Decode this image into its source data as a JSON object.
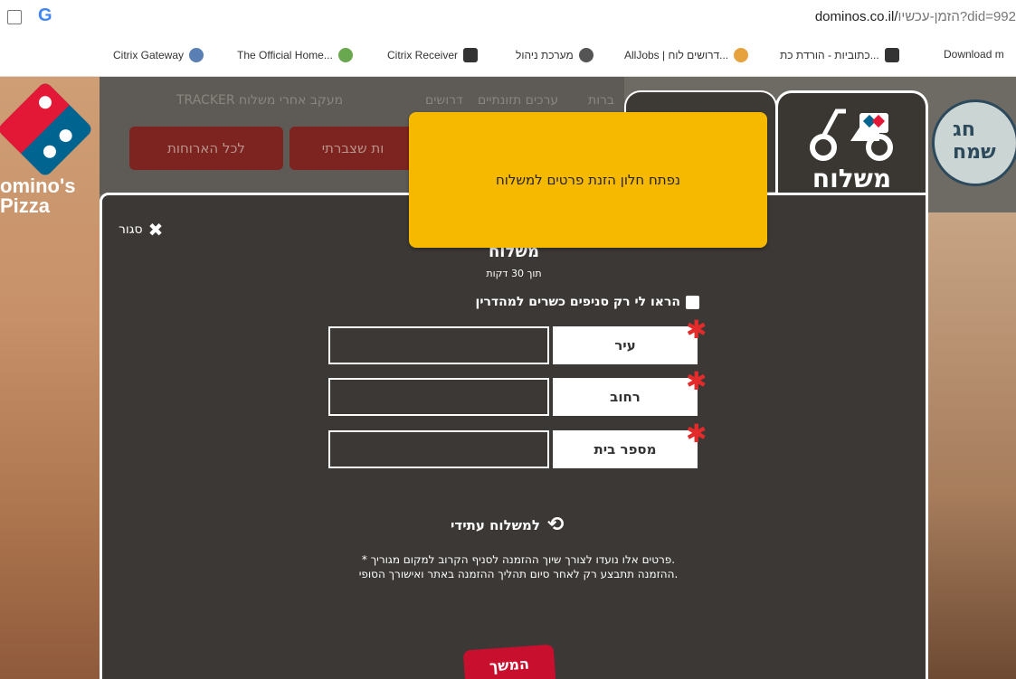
{
  "browser": {
    "url_host": "dominos.co.il/",
    "url_path": "הזמן-עכשיו?did=992",
    "google_icon": "G",
    "bookmarks": [
      {
        "label": "Citrix Gateway",
        "icon": "lock-icon",
        "color": "#5a7fb5"
      },
      {
        "label": "The Official Home...",
        "icon": "site-icon",
        "color": "#6aa84f"
      },
      {
        "label": "Citrix Receiver",
        "icon": "receiver-icon",
        "color": "#333333"
      },
      {
        "label": "מערכת ניהול",
        "icon": "globe-icon",
        "color": "#555555"
      },
      {
        "label": "AllJobs | דרושים לוח...",
        "icon": "jobs-icon",
        "color": "#e6a23c"
      },
      {
        "label": "כתוביות - הורדת כת...",
        "icon": "subs-icon",
        "color": "#333333"
      },
      {
        "label": "Download m",
        "icon": "download-icon",
        "color": "#444444"
      }
    ]
  },
  "background": {
    "brand_line1": "omino's",
    "brand_line2": "Pizza",
    "nav": [
      "TRACKER מעקב אחרי משלוח",
      "דרושים",
      "ערכים תזונתיים",
      "ברות"
    ],
    "red_buttons": [
      "לכל הארוחות",
      "ות שצברתי"
    ],
    "side_badge": "חג שמח"
  },
  "tabs": {
    "active_label": "משלוח"
  },
  "modal": {
    "close_label": "סגור",
    "title": "משלוח",
    "subtitle": "תוך 30 דקות",
    "kosher_label": "הראו לי רק סניפים כשרים למהדרין",
    "fields": [
      {
        "label": "עיר",
        "value": ""
      },
      {
        "label": "רחוב",
        "value": ""
      },
      {
        "label": "מספר בית",
        "value": ""
      }
    ],
    "future_label": "למשלוח עתידי",
    "note_line1": "* פרטים אלו נועדו לצורך שיוך ההזמנה לסניף הקרוב למקום מגוריך.",
    "note_line2": "ההזמנה תתבצע רק לאחר סיום תהליך ההזמנה באתר ואישורך הסופי.",
    "continue_label": "המשך"
  },
  "tooltip": {
    "text": "נפתח חלון הזנת פרטים למשלוח",
    "color": "#f6b900"
  }
}
